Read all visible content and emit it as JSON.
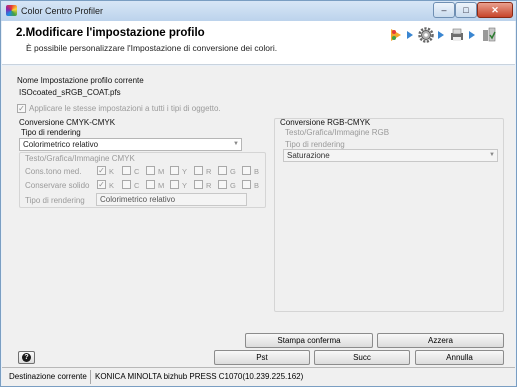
{
  "window": {
    "title": "Color Centro Profiler",
    "minimize_label": "‒",
    "maximize_label": "□",
    "close_label": "✕"
  },
  "header": {
    "title": "2.Modificare l'impostazione profilo",
    "subtitle": "È possibile personalizzare l'Impostazione di conversione dei colori."
  },
  "profile": {
    "name_label": "Nome Impostazione profilo corrente",
    "name_value": "ISOcoated_sRGB_COAT.pfs",
    "apply_all_label": "Applicare le stesse impostazioni a tutti i tipi di oggetto."
  },
  "cmyk": {
    "section_title": "Conversione CMYK-CMYK",
    "rendering_label": "Tipo di rendering",
    "rendering_value": "Colorimetrico relativo",
    "group_title": "Testo/Grafica/Immagine CMYK",
    "rows": [
      {
        "label": "Cons.tono med.",
        "channels": [
          "K",
          "C",
          "M",
          "Y",
          "R",
          "G",
          "B"
        ],
        "checked": [
          true,
          false,
          false,
          false,
          false,
          false,
          false
        ]
      },
      {
        "label": "Conservare solido",
        "channels": [
          "K",
          "C",
          "M",
          "Y",
          "R",
          "G",
          "B"
        ],
        "checked": [
          true,
          false,
          false,
          false,
          false,
          false,
          false
        ]
      }
    ],
    "sub_rendering_label": "Tipo di rendering",
    "sub_rendering_value": "Colorimetrico relativo"
  },
  "rgb": {
    "section_title": "Conversione RGB-CMYK",
    "group_title": "Testo/Grafica/Immagine RGB",
    "rendering_label": "Tipo di rendering",
    "rendering_value": "Saturazione"
  },
  "buttons": {
    "print_confirm": "Stampa conferma",
    "reset": "Azzera",
    "prev": "Pst",
    "next": "Succ",
    "cancel": "Annulla",
    "help": "?"
  },
  "status": {
    "label": "Destinazione corrente",
    "value": "KONICA MINOLTA bizhub PRESS C1070(10.239.225.162)"
  },
  "colors": {
    "accent": "#3a86d1",
    "titlebar": "#bcd3ec",
    "close": "#c7452b"
  },
  "icons": [
    "app-icon",
    "wizard-start-icon",
    "gear-icon",
    "printer-icon",
    "finish-icon"
  ]
}
